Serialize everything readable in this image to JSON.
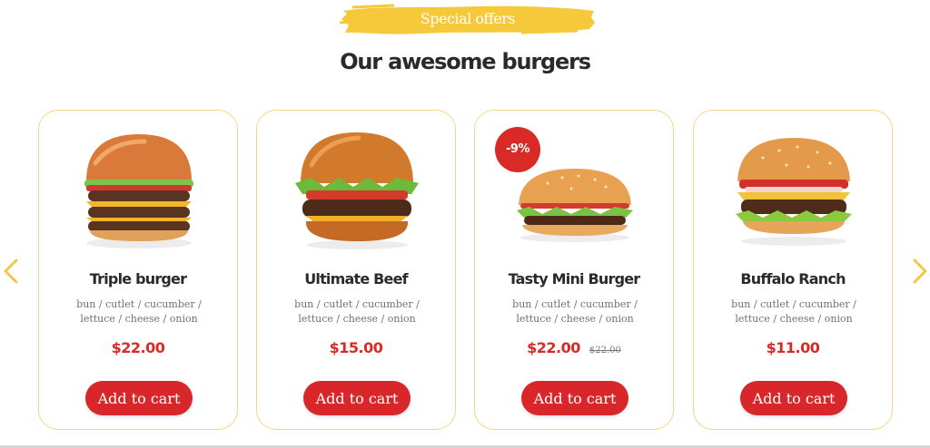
{
  "section": {
    "eyebrow": "Special offers",
    "title": "Our awesome burgers"
  },
  "colors": {
    "accent_red": "#d8262a",
    "brush_yellow": "#f6c93a",
    "card_border": "#f5d58a",
    "arrow_yellow": "#f3c64a"
  },
  "carousel": {
    "prev_icon": "chevron-left-icon",
    "next_icon": "chevron-right-icon"
  },
  "products": [
    {
      "name": "Triple burger",
      "ingredients": "bun / cutlet / cucumber / lettuce / cheese / onion",
      "price": "$22.00",
      "cart_label": "Add to cart",
      "image": "triple-burger-photo"
    },
    {
      "name": "Ultimate Beef",
      "ingredients": "bun / cutlet / cucumber / lettuce / cheese / onion",
      "price": "$15.00",
      "cart_label": "Add to cart",
      "image": "ultimate-beef-burger-photo"
    },
    {
      "name": "Tasty Mini Burger",
      "ingredients": "bun / cutlet / cucumber / lettuce / cheese / onion",
      "price": "$22.00",
      "old_price": "$22.00",
      "discount": "-9%",
      "cart_label": "Add to cart",
      "image": "tasty-mini-burger-photo"
    },
    {
      "name": "Buffalo Ranch",
      "ingredients": "bun / cutlet / cucumber / lettuce / cheese / onion",
      "price": "$11.00",
      "cart_label": "Add to cart",
      "image": "buffalo-ranch-burger-photo"
    }
  ]
}
